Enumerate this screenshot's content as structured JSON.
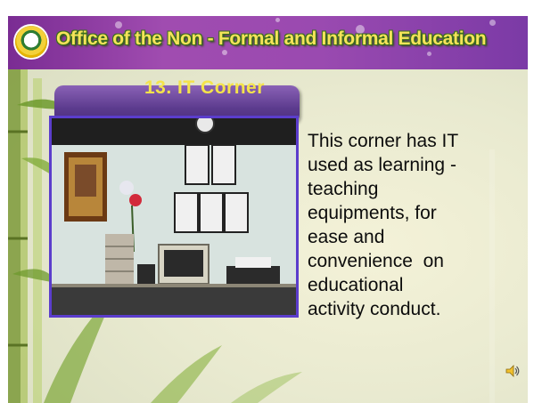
{
  "header": {
    "org_title": "Office of the Non - Formal and Informal Education",
    "logo_icon": "ministry-seal-icon"
  },
  "section": {
    "title": "13. IT Corner"
  },
  "photo": {
    "subject": "it-corner-photo"
  },
  "body": {
    "description_lines": [
      "This corner has IT",
      "used as learning -",
      "teaching",
      "equipments, for",
      "ease and",
      "convenience  on",
      "educational",
      "activity conduct."
    ]
  },
  "controls": {
    "audio_icon": "speaker-icon"
  },
  "colors": {
    "header_purple": "#9a4ab0",
    "title_yellow": "#f4e34a",
    "photo_border": "#5b3dcc",
    "title_bar_purple": "#5c3b8e"
  }
}
